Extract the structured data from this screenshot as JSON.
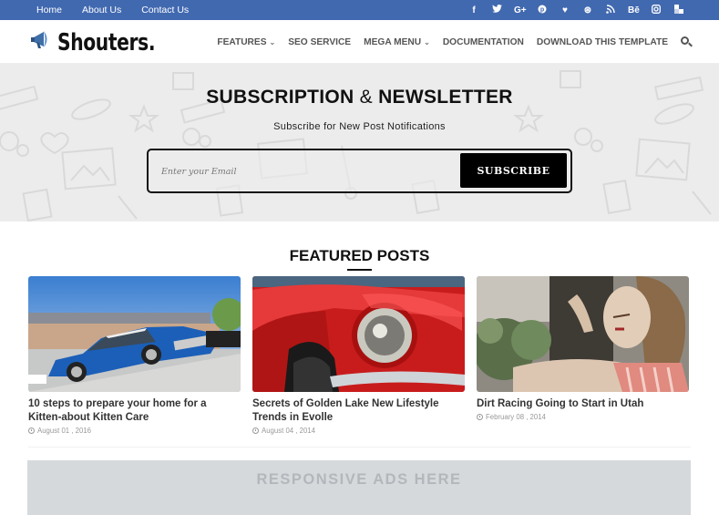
{
  "topbar": {
    "links": [
      "Home",
      "About Us",
      "Contact Us"
    ],
    "social": [
      {
        "name": "facebook-icon",
        "glyph": "f"
      },
      {
        "name": "twitter-icon",
        "glyph": "🐦"
      },
      {
        "name": "google-plus-icon",
        "glyph": "G+"
      },
      {
        "name": "pinterest-icon",
        "glyph": "℗"
      },
      {
        "name": "heart-icon",
        "glyph": "♥"
      },
      {
        "name": "dribbble-icon",
        "glyph": "⊛"
      },
      {
        "name": "rss-icon",
        "glyph": "⋰"
      },
      {
        "name": "behance-icon",
        "glyph": "Bē"
      },
      {
        "name": "instagram-icon",
        "glyph": "◎"
      },
      {
        "name": "delicious-icon",
        "glyph": "▚"
      }
    ],
    "bg_color": "#4169b0"
  },
  "header": {
    "logo_text": "Shouters.",
    "nav": [
      {
        "label": "FEATURES",
        "dropdown": true
      },
      {
        "label": "SEO SERVICE",
        "dropdown": false
      },
      {
        "label": "MEGA MENU",
        "dropdown": true
      },
      {
        "label": "DOCUMENTATION",
        "dropdown": false
      },
      {
        "label": "DOWNLOAD THIS TEMPLATE",
        "dropdown": false
      }
    ],
    "chevron": "⌄"
  },
  "subscription": {
    "title_left": "SUBSCRIPTION",
    "title_amp": "&",
    "title_right": "NEWSLETTER",
    "caption": "Subscribe for New Post Notifications",
    "email_placeholder": "Enter your Email",
    "button_label": "SUBSCRIBE"
  },
  "featured": {
    "title": "FEATURED POSTS",
    "posts": [
      {
        "title": "10 steps to prepare your home for a Kitten-about Kitten Care",
        "date": "August 01 , 2016",
        "image": "blue-classic-car"
      },
      {
        "title": "Secrets of Golden Lake New Lifestyle Trends in Evolle",
        "date": "August 04 , 2014",
        "image": "red-car-headlight"
      },
      {
        "title": "Dirt Racing Going to Start in Utah",
        "date": "February 08 , 2014",
        "image": "woman-portrait"
      }
    ]
  },
  "ads": {
    "label": "RESPONSIVE ADS HERE"
  }
}
